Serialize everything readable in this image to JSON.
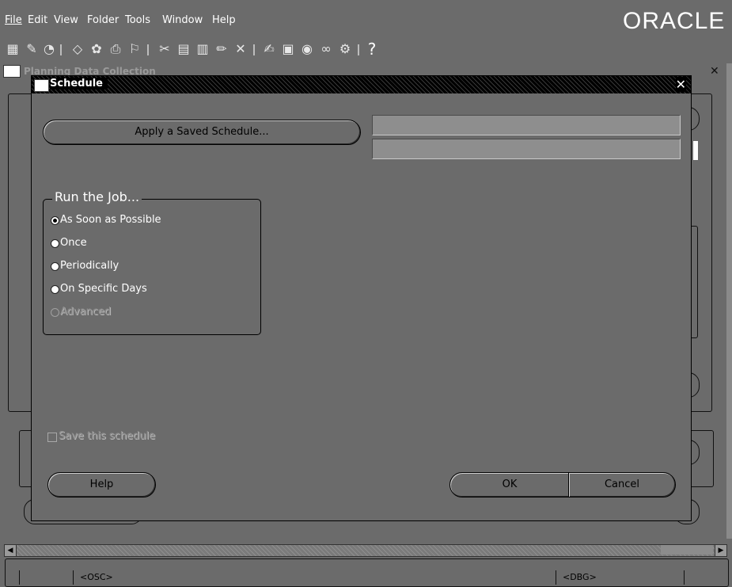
{
  "menubar": {
    "items": [
      {
        "label": "File",
        "mnemonic": "F"
      },
      {
        "label": "Edit",
        "mnemonic": "E"
      },
      {
        "label": "View",
        "mnemonic": "V"
      },
      {
        "label": "Folder",
        "mnemonic": "l"
      },
      {
        "label": "Tools",
        "mnemonic": "T"
      },
      {
        "label": "Window",
        "mnemonic": "W"
      },
      {
        "label": "Help",
        "mnemonic": "H"
      }
    ],
    "brand": "ORACLE"
  },
  "toolbar": {
    "icons": [
      "save-icon",
      "navigate-icon",
      "zoom-icon",
      "find-icon",
      "translate-icon",
      "print-icon",
      "attachment-image-icon",
      "cut-icon",
      "copy-icon",
      "paste-icon",
      "edit-icon",
      "clear-icon",
      "pen-icon",
      "folder-icon",
      "stop-icon",
      "attach-icon",
      "key-icon",
      "help-icon"
    ],
    "help_glyph": "?"
  },
  "background_window": {
    "title": "Planning Data Collection"
  },
  "dialog": {
    "title": "Schedule",
    "apply_saved_schedule_label": "Apply a Saved Schedule...",
    "apply_saved_schedule_mnemonic": "v",
    "schedule_name_value": "",
    "schedule_desc_value": "",
    "run_group": {
      "legend": "Run the Job...",
      "options": [
        {
          "label": "As Soon as Possible",
          "mnemonic": "b",
          "selected": true,
          "enabled": true
        },
        {
          "label": "Once",
          "mnemonic": "n",
          "selected": false,
          "enabled": true
        },
        {
          "label": "Periodically",
          "mnemonic": "P",
          "selected": false,
          "enabled": true
        },
        {
          "label": "On Specific Days",
          "mnemonic": "D",
          "selected": false,
          "enabled": true
        },
        {
          "label": "Advanced",
          "mnemonic": "A",
          "selected": false,
          "enabled": false
        }
      ]
    },
    "save_schedule": {
      "label": "Save this schedule",
      "checked": false,
      "enabled": false
    },
    "help_button": "Help",
    "ok_button": "OK",
    "cancel_button": "Cancel"
  },
  "statusbar": {
    "osc": "<OSC>",
    "dbg": "<DBG>"
  },
  "colors": {
    "background": "#6b6b6b",
    "titlebar": "#000000",
    "text_light": "#ffffff",
    "field": "#8e8e8e"
  }
}
